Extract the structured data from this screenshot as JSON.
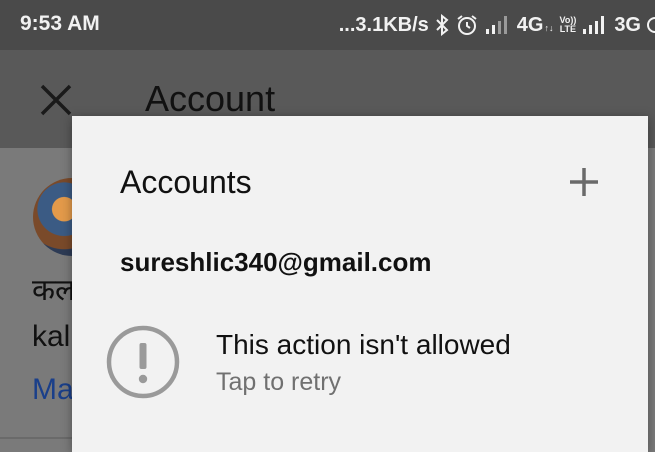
{
  "status_bar": {
    "time": "9:53 AM",
    "net_speed": "...3.1KB/s",
    "network_1": "4G",
    "network_1_tag": "↑↓",
    "volte_top": "Vo))",
    "volte_bottom": "LTE",
    "network_2": "3G",
    "icons": [
      "bluetooth-icon",
      "alarm-icon",
      "signal-icon",
      "signal-icon"
    ]
  },
  "app_bar": {
    "title": "Account"
  },
  "background": {
    "line1": "कल",
    "line2": "kal",
    "link": "Ma"
  },
  "dialog": {
    "title": "Accounts",
    "email": "sureshlic340@gmail.com",
    "error_title": "This action isn't allowed",
    "error_subtitle": "Tap to retry"
  },
  "colors": {
    "status_bar": "#4a4a4a",
    "scrim": "#595959",
    "dialog": "#f2f2f2",
    "link": "#1a3f8a",
    "secondary_text": "#707070"
  }
}
